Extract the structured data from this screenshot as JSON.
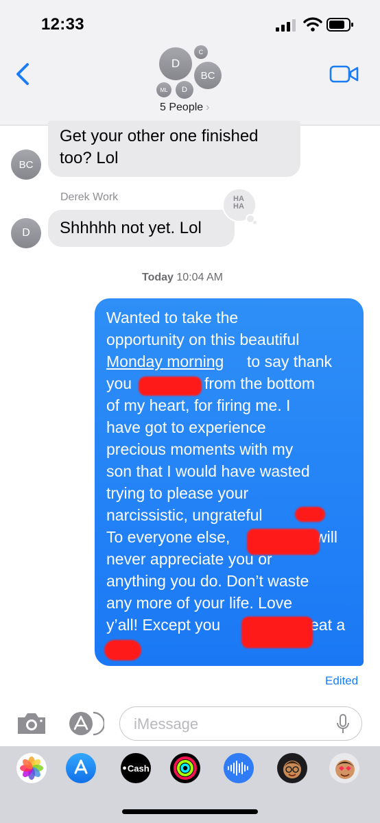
{
  "status_bar": {
    "time": "12:33"
  },
  "header": {
    "participants_label": "5 People",
    "avatars": [
      {
        "initials": "D"
      },
      {
        "initials": "C"
      },
      {
        "initials": "BC"
      },
      {
        "initials": "ML"
      },
      {
        "initials": "D"
      }
    ]
  },
  "messages": [
    {
      "direction": "incoming",
      "avatar": "BC",
      "lines": [
        "Get your other one finished",
        "too? Lol"
      ]
    },
    {
      "direction": "incoming",
      "sender": "Derek Work",
      "avatar": "D",
      "lines": [
        "Shhhhh not yet. Lol"
      ],
      "tapback": "HA HA"
    },
    {
      "timestamp_day": "Today",
      "timestamp_time": "10:04 AM"
    },
    {
      "direction": "outgoing",
      "lines": [
        "Wanted to take the",
        "opportunity on this beautiful",
        "to say thank",
        "you",
        "from the bottom",
        "of my heart, for firing me. I",
        "have got to experience",
        "precious moments with my",
        "son that I would have wasted",
        "trying to please your",
        "narcissistic, ungrateful",
        ".",
        "To everyone else,",
        "will",
        "never appreciate you or",
        "anything you do. Don’t waste",
        "any more of your life. Love",
        "y’all!  Except you",
        "eat a"
      ],
      "link_text": "Monday morning",
      "status": "Edited"
    }
  ],
  "input": {
    "placeholder": "iMessage"
  },
  "drawer": {
    "apps": [
      "photos-app",
      "app-store",
      "apple-cash",
      "activity",
      "audio-message",
      "memoji",
      "memoji-stickers"
    ],
    "cash_label": "Cash"
  }
}
